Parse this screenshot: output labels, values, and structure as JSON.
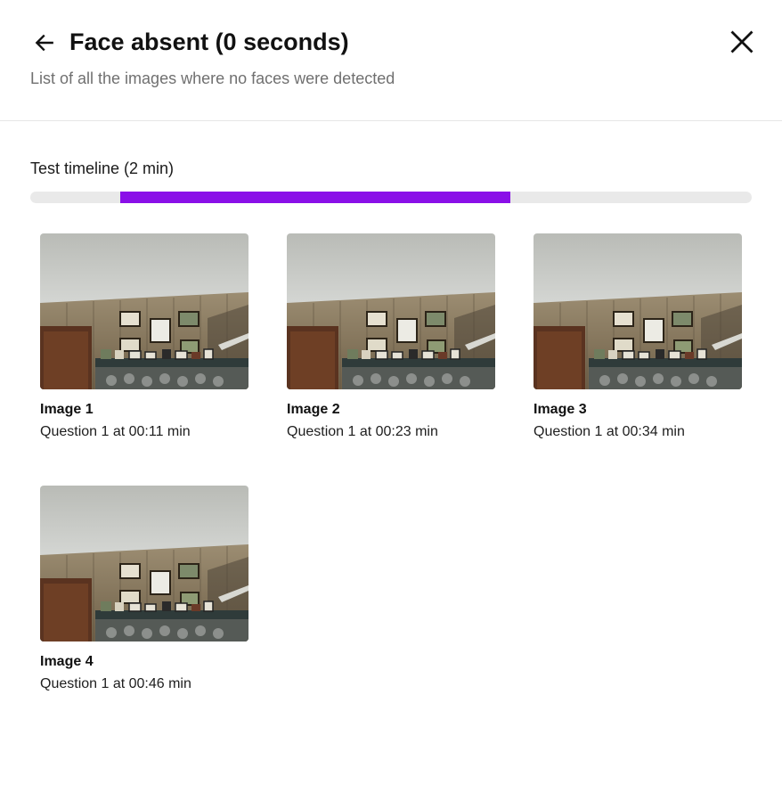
{
  "header": {
    "title": "Face absent (0 seconds)",
    "subtitle": "List of all the images where no faces were detected",
    "back_icon": "arrow-left-icon",
    "close_icon": "close-icon"
  },
  "timeline": {
    "label": "Test timeline (2 min)",
    "duration_min": 2,
    "segment": {
      "start_fraction": 0.125,
      "end_fraction": 0.666
    },
    "track_color": "#e9e9e9",
    "segment_color": "#8a0fe8"
  },
  "images": [
    {
      "title": "Image 1",
      "caption": "Question 1 at 00:11 min"
    },
    {
      "title": "Image 2",
      "caption": "Question 1 at 00:23 min"
    },
    {
      "title": "Image 3",
      "caption": "Question 1 at 00:34 min"
    },
    {
      "title": "Image 4",
      "caption": "Question 1 at 00:46 min"
    }
  ]
}
